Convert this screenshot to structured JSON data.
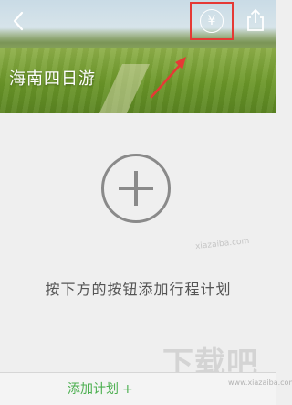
{
  "header": {
    "back_icon": "chevron-left-icon",
    "currency_icon": "yuan-coin-icon",
    "currency_symbol": "¥",
    "share_icon": "share-icon",
    "title": "海南四日游",
    "highlight_color": "#e53935"
  },
  "main": {
    "add_icon": "plus-circle-icon",
    "hint": "按下方的按钮添加行程计划"
  },
  "footer": {
    "add_plan_label": "添加计划",
    "add_plan_plus": "+",
    "accent_color": "#4caf50"
  },
  "watermark": {
    "site": "xiazaiba.com",
    "logo": "下载吧",
    "url": "www.xiazaiba.com"
  }
}
